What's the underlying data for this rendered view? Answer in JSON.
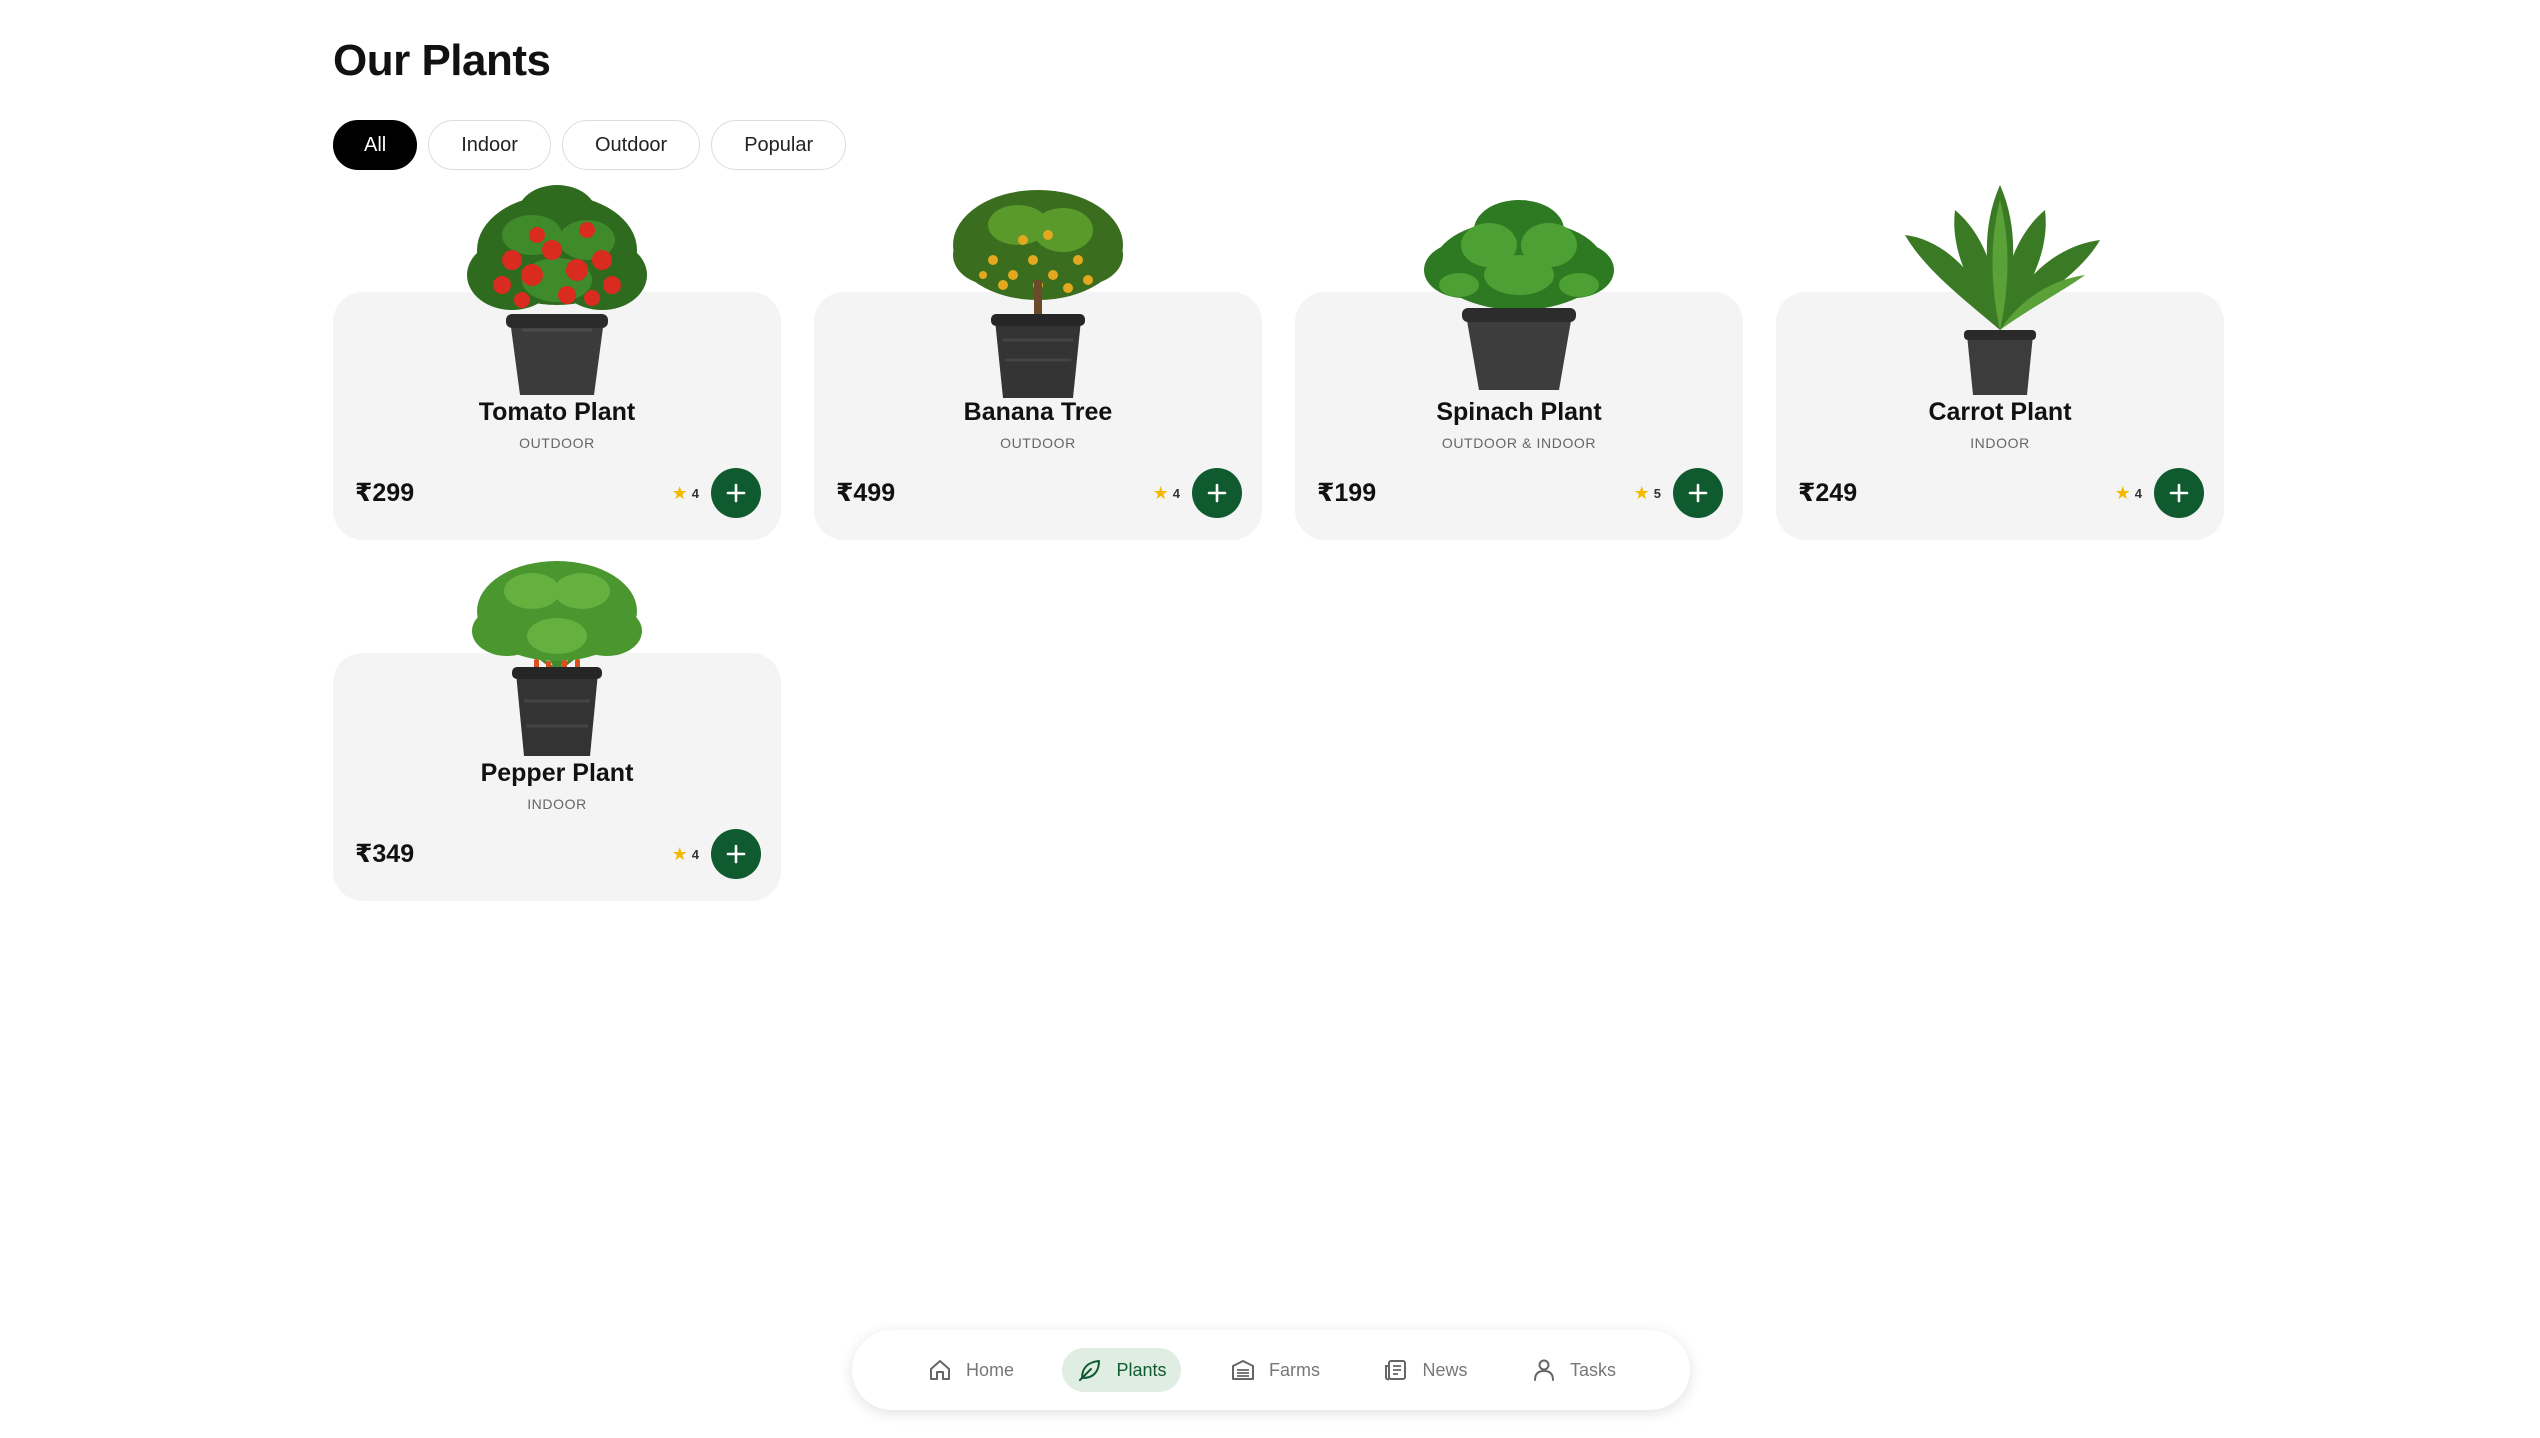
{
  "page": {
    "title": "Our Plants"
  },
  "filters": [
    {
      "label": "All",
      "active": true
    },
    {
      "label": "Indoor",
      "active": false
    },
    {
      "label": "Outdoor",
      "active": false
    },
    {
      "label": "Popular",
      "active": false
    }
  ],
  "plants": [
    {
      "name": "Tomato Plant",
      "type": "OUTDOOR",
      "price": "₹299",
      "rating": "4",
      "art": "tomato"
    },
    {
      "name": "Banana Tree",
      "type": "OUTDOOR",
      "price": "₹499",
      "rating": "4",
      "art": "banana"
    },
    {
      "name": "Spinach Plant",
      "type": "OUTDOOR & INDOOR",
      "price": "₹199",
      "rating": "5",
      "art": "spinach"
    },
    {
      "name": "Carrot Plant",
      "type": "INDOOR",
      "price": "₹249",
      "rating": "4",
      "art": "carrot"
    },
    {
      "name": "Pepper Plant",
      "type": "INDOOR",
      "price": "₹349",
      "rating": "4",
      "art": "pepper"
    }
  ],
  "nav": {
    "items": [
      {
        "label": "Home",
        "icon": "home-icon",
        "active": false
      },
      {
        "label": "Plants",
        "icon": "leaf-icon",
        "active": true
      },
      {
        "label": "Farms",
        "icon": "warehouse-icon",
        "active": false
      },
      {
        "label": "News",
        "icon": "newspaper-icon",
        "active": false
      },
      {
        "label": "Tasks",
        "icon": "user-icon",
        "active": false
      }
    ]
  },
  "colors": {
    "accent": "#0f5a2f",
    "star": "#f5b800",
    "card_bg": "#f3f4f3",
    "active_chip": "#000000",
    "active_nav_bg": "#dfede3"
  }
}
